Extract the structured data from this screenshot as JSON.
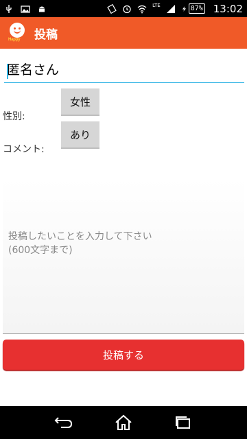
{
  "status_bar": {
    "battery": "87%",
    "network": "LTE",
    "time": "13:02"
  },
  "action_bar": {
    "logo_text": "Happy",
    "title": "投稿"
  },
  "form": {
    "name_value": "匿名さん",
    "gender_label": "性別:",
    "gender_value": "女性",
    "comment_label": "コメント:",
    "comment_value": "あり",
    "message_placeholder_line1": "投稿したいことを入力して下さい",
    "message_placeholder_line2": "(600文字まで)",
    "submit_label": "投稿する"
  },
  "colors": {
    "action_bar": "#f05a28",
    "submit": "#e73030",
    "focus": "#33b5e5"
  }
}
